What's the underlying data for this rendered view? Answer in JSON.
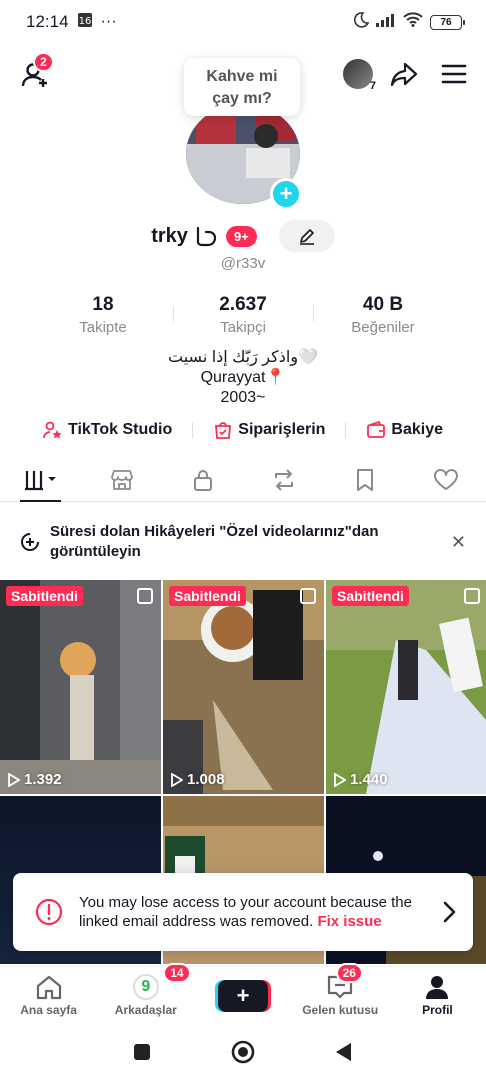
{
  "status_bar": {
    "time": "12:14",
    "dots": "···",
    "battery": "76"
  },
  "top_bar": {
    "add_friends_badge": "2",
    "story_badge": "7"
  },
  "tooltip": {
    "line1": "Kahve mi",
    "line2": "çay mı?"
  },
  "profile": {
    "name": "trky",
    "badge": "9+",
    "handle": "@r33v",
    "stats": [
      {
        "value": "18",
        "label": "Takipte"
      },
      {
        "value": "2.637",
        "label": "Takipçi"
      },
      {
        "value": "40 B",
        "label": "Beğeniler"
      }
    ],
    "bio": [
      "واذكر رَبّك إذا نسيت🤍",
      "Qurayyat📍",
      "2003~"
    ]
  },
  "links": {
    "studio": "TikTok Studio",
    "orders": "Siparişlerin",
    "balance": "Bakiye"
  },
  "banner": {
    "text": "Süresi dolan Hikâyeleri \"Özel videolarınız\"dan görüntüleyin"
  },
  "videos": [
    {
      "pinned": "Sabitlendi",
      "views": "1.392"
    },
    {
      "pinned": "Sabitlendi",
      "views": "1.008"
    },
    {
      "pinned": "Sabitlendi",
      "views": "1.440"
    }
  ],
  "alert": {
    "text": "You may lose access to your account because the linked email address was removed.",
    "fix": "Fix issue"
  },
  "bottom_nav": {
    "home": "Ana sayfa",
    "friends": "Arkadaşlar",
    "friends_badge": "14",
    "inbox": "Gelen kutusu",
    "inbox_badge": "26",
    "profile": "Profil"
  },
  "colors": {
    "accent": "#fe2c55",
    "cyan": "#20d5ec",
    "text": "#161823"
  }
}
